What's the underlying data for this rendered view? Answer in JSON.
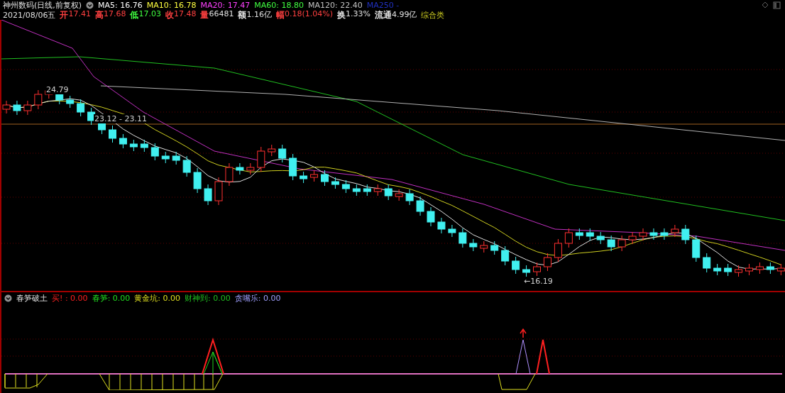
{
  "header": {
    "stock": "神州数码(日线,前复权)",
    "ma": [
      {
        "label": "MA5: 16.76",
        "color": "#ffffff"
      },
      {
        "label": "MA10: 16.78",
        "color": "#ffff40"
      },
      {
        "label": "MA20: 17.47",
        "color": "#ff40ff"
      },
      {
        "label": "MA60: 18.80",
        "color": "#40ff40"
      },
      {
        "label": "MA120: 22.40",
        "color": "#c0c0c0"
      },
      {
        "label": "MA250 -",
        "color": "#2030c0"
      }
    ]
  },
  "quote": {
    "date": "2021/08/06五",
    "fields": [
      {
        "label": {
          "text": "开",
          "color": "#ff4040"
        },
        "value": {
          "text": "17.41",
          "color": "#ff4040"
        }
      },
      {
        "label": {
          "text": "高",
          "color": "#ff4040"
        },
        "value": {
          "text": "17.68",
          "color": "#ff4040"
        }
      },
      {
        "label": {
          "text": "低",
          "color": "#40ff40"
        },
        "value": {
          "text": "17.03",
          "color": "#40ff40"
        }
      },
      {
        "label": {
          "text": "收",
          "color": "#ff4040"
        },
        "value": {
          "text": "17.48",
          "color": "#ff4040"
        }
      },
      {
        "label": {
          "text": "量",
          "color": "#ff4040"
        },
        "value": {
          "text": "66481",
          "color": "#e0e0e0"
        }
      },
      {
        "label": {
          "text": "额",
          "color": "#e0e0e0"
        },
        "value": {
          "text": "1.16亿",
          "color": "#e0e0e0"
        }
      },
      {
        "label": {
          "text": "幅",
          "color": "#ff4040"
        },
        "value": {
          "text": "0.18(1.04%)",
          "color": "#ff4040"
        }
      },
      {
        "label": {
          "text": "换",
          "color": "#e0e0e0"
        },
        "value": {
          "text": "1.33%",
          "color": "#e0e0e0"
        }
      },
      {
        "label": {
          "text": "流通",
          "color": "#e0e0e0"
        },
        "value": {
          "text": "4.99亿",
          "color": "#e0e0e0"
        }
      }
    ],
    "category": "综合类"
  },
  "chart": {
    "annotations": [
      {
        "text": "24.79"
      },
      {
        "text": "23.12 - 23.11"
      },
      {
        "text": "←16.19"
      }
    ]
  },
  "indicator": {
    "name": "春笋破土",
    "values": [
      {
        "label": "买!",
        "value": " : 0.00",
        "color": "#ff2020"
      },
      {
        "label": "春笋",
        "value": ": 0.00",
        "color": "#20e020"
      },
      {
        "label": "黄金坑",
        "value": ": 0.00",
        "color": "#e0e020"
      },
      {
        "label": "财神到",
        "value": ": 0.00",
        "color": "#20c020"
      },
      {
        "label": "贪嘴乐",
        "value": ": 0.00",
        "color": "#a0a0ff"
      }
    ]
  }
}
